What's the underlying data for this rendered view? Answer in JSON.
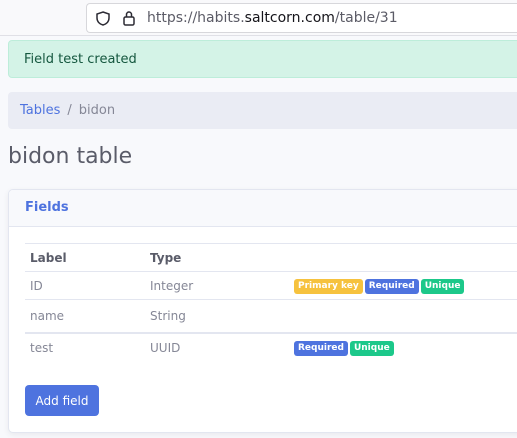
{
  "browser": {
    "url_prefix": "https://habits.",
    "url_host": "saltcorn.com",
    "url_path": "/table/31"
  },
  "alert": {
    "message": "Field test created"
  },
  "breadcrumb": {
    "parent": "Tables",
    "separator": "/",
    "current": "bidon"
  },
  "page": {
    "title": "bidon table"
  },
  "card": {
    "header": "Fields"
  },
  "fields_table": {
    "headers": [
      "Label",
      "Type"
    ],
    "rows": [
      {
        "label": "ID",
        "type": "Integer",
        "badges": [
          "Primary key",
          "Required",
          "Unique"
        ]
      },
      {
        "label": "name",
        "type": "String",
        "badges": []
      },
      {
        "label": "test",
        "type": "UUID",
        "badges": [
          "Required",
          "Unique"
        ]
      }
    ]
  },
  "actions": {
    "add_field": "Add field"
  },
  "colors": {
    "primary": "#4e73df",
    "success": "#1cc88a",
    "warning": "#f6c23e",
    "alert_bg": "#d4f3e7"
  }
}
